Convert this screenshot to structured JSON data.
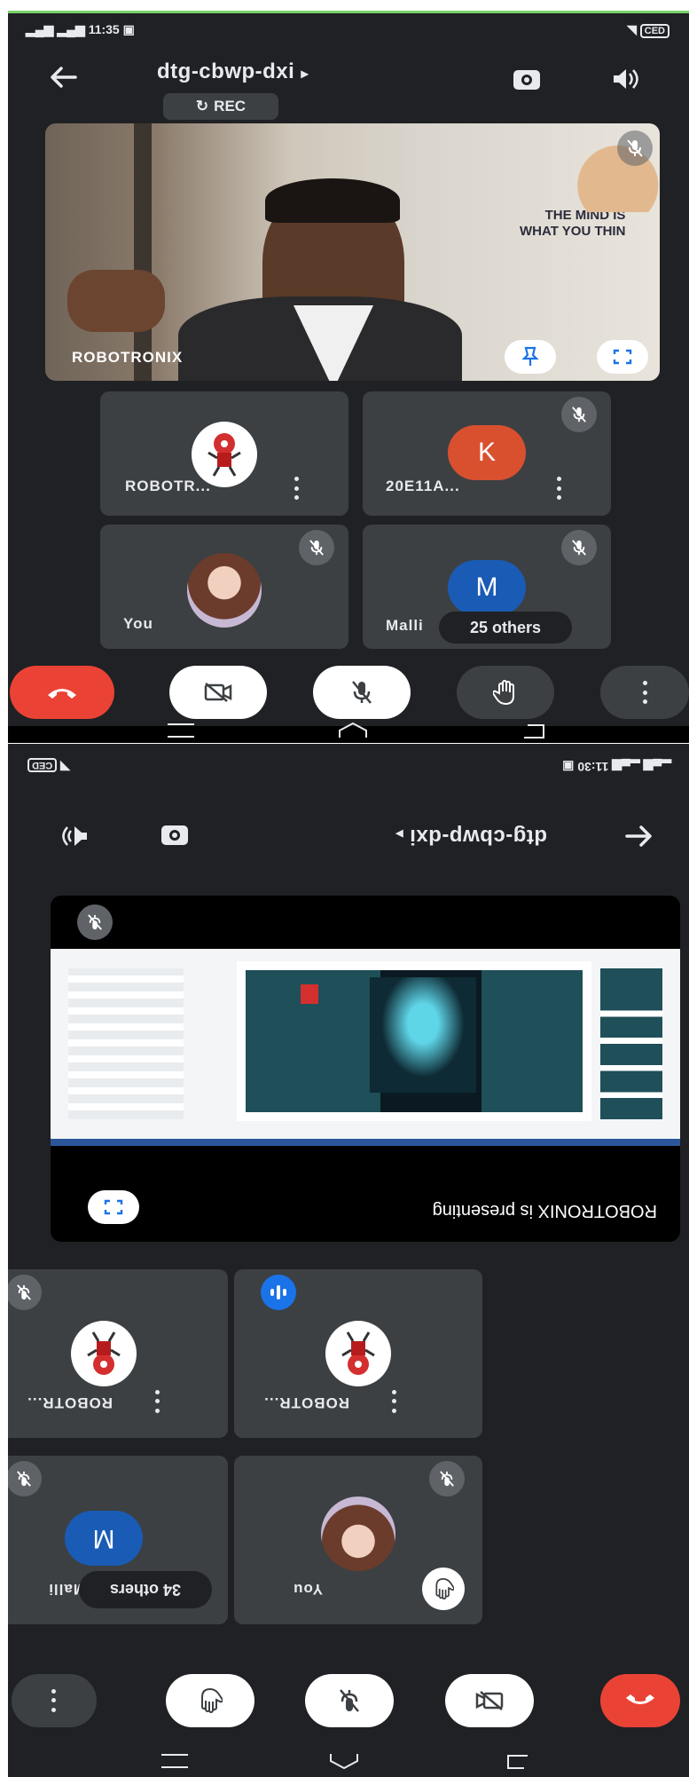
{
  "top": {
    "status": {
      "time": "11:35",
      "signal": "ᵀᵉ ᴸ",
      "battery": "CED"
    },
    "header": {
      "meeting_code": "dtg-cbwp-dxi",
      "arrow": "▸",
      "rec_label": "REC",
      "rec_icon": "↻"
    },
    "main_video": {
      "name": "ROBOTRONIX",
      "poster_text": [
        "THE MIND IS",
        "WHAT YOU THIN"
      ]
    },
    "tiles": [
      {
        "name": "ROBOTR...",
        "avatar": "robot"
      },
      {
        "name": "20E11A...",
        "avatar": "letter",
        "letter": "K",
        "color": "#d9502f"
      },
      {
        "name": "You",
        "avatar": "photo"
      },
      {
        "name": "Malli",
        "avatar": "letter",
        "letter": "M",
        "color": "#1a5bb5",
        "others": "25 others"
      }
    ]
  },
  "bottom": {
    "status": {
      "time": "11:30",
      "battery": "CED"
    },
    "header": {
      "meeting_code": "dtg-cbwp-dxi",
      "arrow": "▸"
    },
    "presentation": {
      "caption": "ROBOTRONIX is presenting"
    },
    "tiles": [
      {
        "name": "ROBOTR...",
        "avatar": "robot"
      },
      {
        "name": "ROBOTR...",
        "avatar": "robot"
      },
      {
        "name": "You",
        "avatar": "photo"
      },
      {
        "name": "Malli",
        "avatar": "letter",
        "letter": "M",
        "color": "#1a5bb5",
        "others": "34 others"
      }
    ]
  },
  "colors": {
    "background": "#202124",
    "tile": "#3c4043",
    "end_call": "#ea4335",
    "accent_green": "#7ad36a",
    "speaking_blue": "#1a73e8"
  },
  "icons": [
    "back-arrow-icon",
    "camera-switch-icon",
    "speaker-icon",
    "pin-icon",
    "fullscreen-icon",
    "mic-off-icon",
    "video-off-icon",
    "raise-hand-icon",
    "end-call-icon",
    "more-icon",
    "speaking-indicator-icon"
  ]
}
